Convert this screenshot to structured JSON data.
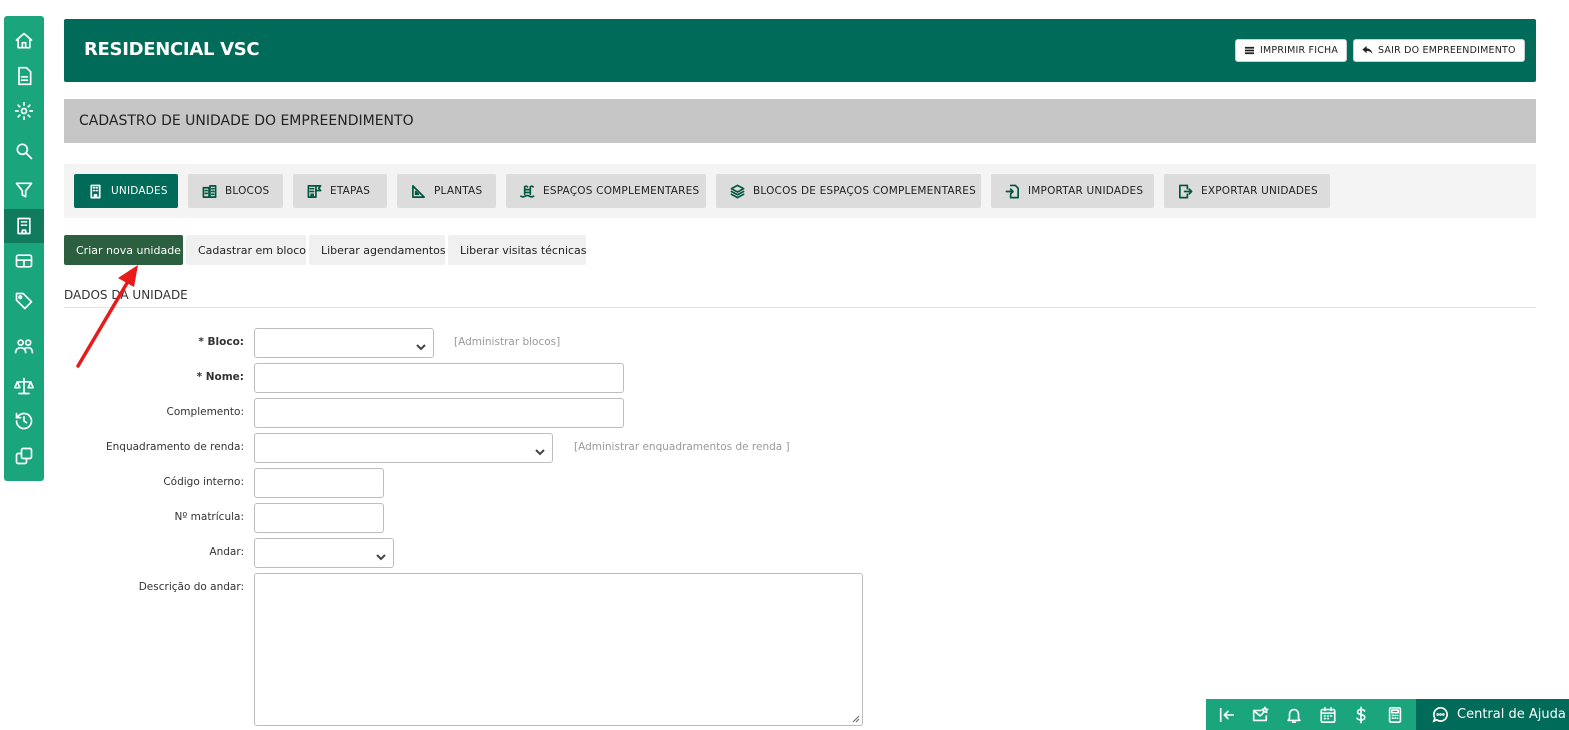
{
  "sidebar": {
    "items": [
      {
        "icon": "home-icon"
      },
      {
        "icon": "document-icon"
      },
      {
        "icon": "gear-icon"
      },
      {
        "icon": "search-icon"
      },
      {
        "icon": "filter-icon"
      },
      {
        "icon": "building-icon",
        "active": true
      },
      {
        "icon": "table-icon"
      },
      {
        "icon": "tag-icon"
      },
      {
        "icon": "users-icon"
      },
      {
        "icon": "scale-icon"
      },
      {
        "icon": "history-icon"
      },
      {
        "icon": "copy-icon"
      }
    ]
  },
  "header": {
    "title": "RESIDENCIAL VSC",
    "print_label": "IMPRIMIR FICHA",
    "exit_label": "SAIR DO EMPREENDIMENTO"
  },
  "subheader": {
    "title": "CADASTRO DE UNIDADE DO EMPREENDIMENTO"
  },
  "tabs": [
    {
      "label": "UNIDADES",
      "icon": "building-icon",
      "active": true
    },
    {
      "label": "BLOCOS",
      "icon": "blocks-icon"
    },
    {
      "label": "ETAPAS",
      "icon": "stages-icon"
    },
    {
      "label": "PLANTAS",
      "icon": "set-square-icon"
    },
    {
      "label": "ESPAÇOS COMPLEMENTARES",
      "icon": "pool-icon"
    },
    {
      "label": "BLOCOS DE ESPAÇOS COMPLEMENTARES",
      "icon": "layers-icon"
    },
    {
      "label": "IMPORTAR UNIDADES",
      "icon": "import-icon"
    },
    {
      "label": "EXPORTAR UNIDADES",
      "icon": "export-icon"
    }
  ],
  "actions": {
    "create": "Criar nova unidade",
    "bulk": "Cadastrar em bloco",
    "release_schedules": "Liberar agendamentos",
    "release_visits": "Liberar visitas técnicas"
  },
  "section": {
    "title": "DADOS DA UNIDADE"
  },
  "form": {
    "bloco_label": "* Bloco:",
    "bloco_value": "",
    "bloco_hint": "[Administrar blocos]",
    "nome_label": "* Nome:",
    "nome_value": "",
    "complemento_label": "Complemento:",
    "complemento_value": "",
    "enquadramento_label": "Enquadramento de renda:",
    "enquadramento_value": "",
    "enquadramento_hint": "[Administrar enquadramentos de renda ]",
    "codigo_label": "Código interno:",
    "codigo_value": "",
    "matricula_label": "Nº matrícula:",
    "matricula_value": "",
    "andar_label": "Andar:",
    "andar_value": "",
    "descricao_label": "Descrição do andar:",
    "descricao_value": ""
  },
  "bottombar": {
    "icons": [
      "collapse-left-icon",
      "mail-star-icon",
      "bell-icon",
      "calendar-icon",
      "dollar-icon",
      "calculator-icon"
    ],
    "help_label": "Central de Ajuda"
  },
  "colors": {
    "primary": "#006b58",
    "sidebar": "#1aa57c",
    "create_button": "#2c5f3f",
    "annotation_arrow": "#e81a1a"
  }
}
